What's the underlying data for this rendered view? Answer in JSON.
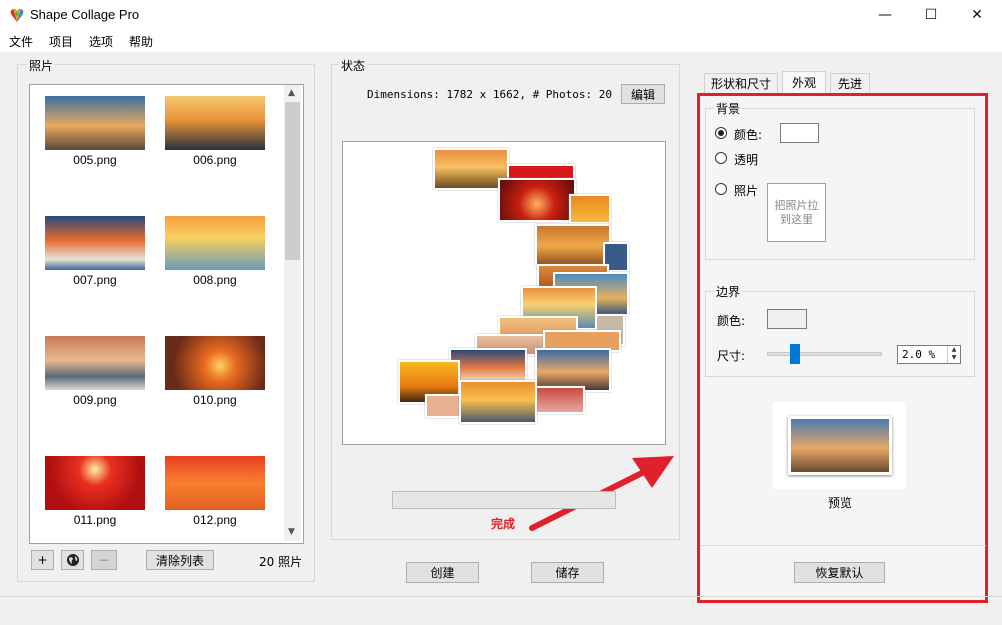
{
  "window": {
    "title": "Shape Collage Pro",
    "minimize": "—",
    "maximize": "☐",
    "close": "✕"
  },
  "menu": [
    "文件",
    "项目",
    "选项",
    "帮助"
  ],
  "photos": {
    "group_title": "照片",
    "items": [
      "005.png",
      "006.png",
      "007.png",
      "008.png",
      "009.png",
      "010.png",
      "011.png",
      "012.png"
    ],
    "add_label": "+",
    "remove_label": "−",
    "clear_label": "清除列表",
    "count_text": "20 照片"
  },
  "status": {
    "group_title": "状态",
    "dimensions_text": "Dimensions: 1782 x 1662, # Photos: 20",
    "edit_label": "编辑",
    "done_text": "完成",
    "progress": 0
  },
  "actions": {
    "create_label": "创建",
    "save_label": "储存"
  },
  "tabs": {
    "items": [
      "形状和尺寸",
      "外观",
      "先进"
    ],
    "active": "外观"
  },
  "appearance": {
    "background": {
      "title": "背景",
      "color_label": "颜色:",
      "transparent_label": "透明",
      "photo_label": "照片",
      "drop_hint": "把照片拉到这里",
      "selected": "颜色"
    },
    "border": {
      "title": "边界",
      "color_label": "颜色:",
      "size_label": "尺寸:",
      "size_value": "2.0 %",
      "slider_fraction": 0.2
    },
    "preview_label": "预览",
    "reset_label": "恢复默认"
  },
  "colors": {
    "highlight": "#e0202a",
    "done_text": "#e0202a"
  }
}
